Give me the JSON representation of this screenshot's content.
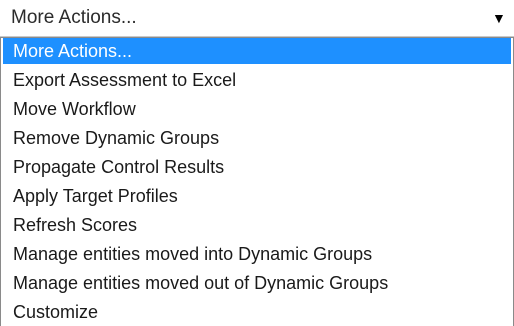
{
  "select": {
    "value": "More Actions...",
    "arrow_icon": "caret-down-icon"
  },
  "options": [
    "More Actions...",
    "Export Assessment to Excel",
    "Move Workflow",
    "Remove Dynamic Groups",
    "Propagate Control Results",
    "Apply Target Profiles",
    "Refresh Scores",
    "Manage entities moved into Dynamic Groups",
    "Manage entities moved out of Dynamic Groups",
    "Customize"
  ],
  "selected_index": 0,
  "colors": {
    "highlight": "#1e90ff",
    "highlight_text": "#ffffff",
    "text": "#1a1a1a"
  }
}
